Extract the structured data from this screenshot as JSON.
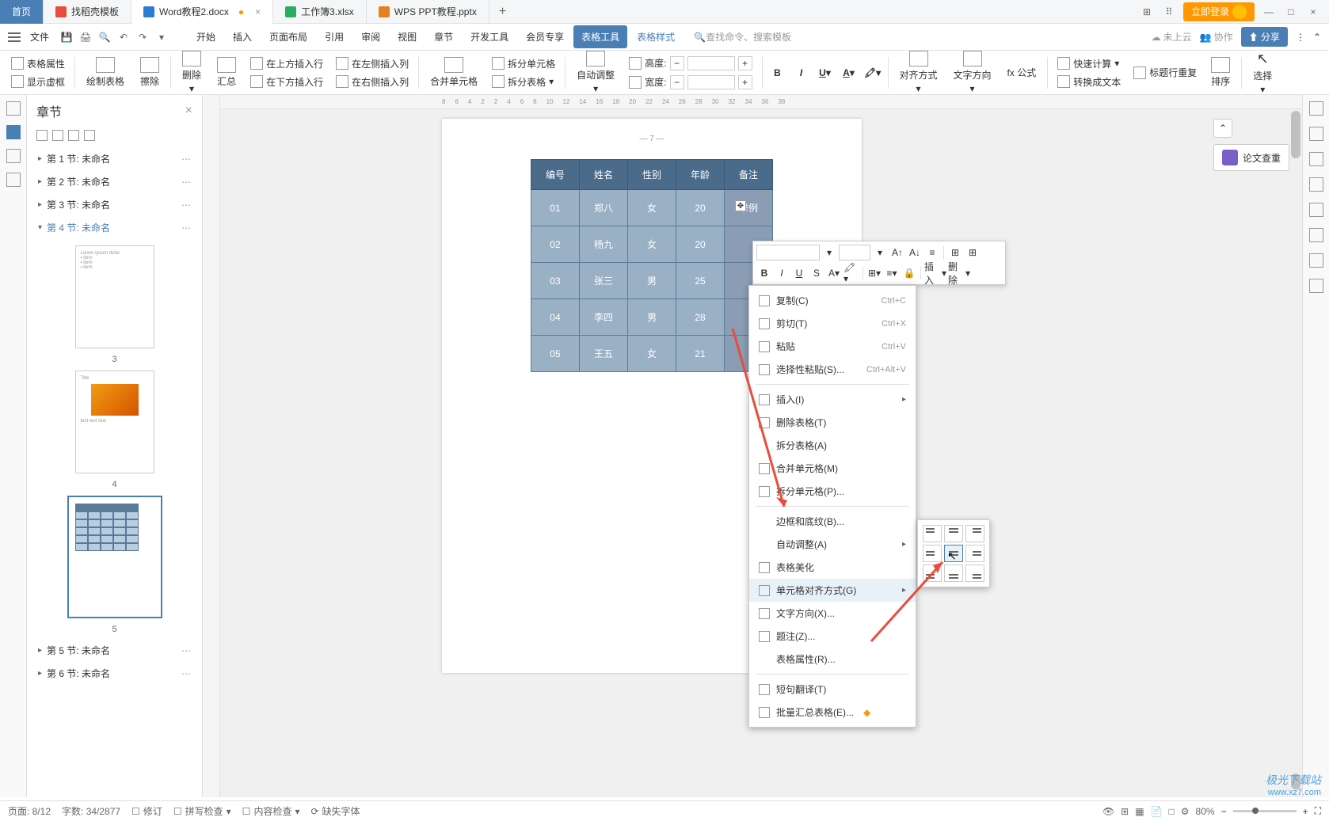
{
  "tabs": {
    "home": "首页",
    "items": [
      {
        "icon": "red",
        "label": "找稻壳模板"
      },
      {
        "icon": "blue",
        "label": "Word教程2.docx",
        "active": true,
        "modified": true
      },
      {
        "icon": "green",
        "label": "工作簿3.xlsx"
      },
      {
        "icon": "orange",
        "label": "WPS PPT教程.pptx"
      }
    ]
  },
  "title_bar": {
    "login": "立即登录"
  },
  "file_menu": "文件",
  "menu": {
    "items": [
      "开始",
      "插入",
      "页面布局",
      "引用",
      "审阅",
      "视图",
      "章节",
      "开发工具",
      "会员专享"
    ],
    "active": "表格工具",
    "link": "表格样式"
  },
  "search": {
    "placeholder": "查找命令、搜索模板"
  },
  "toolbar_right": {
    "cloud": "未上云",
    "collab": "协作",
    "share": "分享"
  },
  "ribbon": {
    "table_props": "表格属性",
    "show_grid": "显示虚框",
    "draw_table": "绘制表格",
    "eraser": "擦除",
    "delete": "删除",
    "summary": "汇总",
    "insert_above": "在上方插入行",
    "insert_below": "在下方插入行",
    "insert_left": "在左侧插入列",
    "insert_right": "在右侧插入列",
    "merge": "合并单元格",
    "split_cell": "拆分单元格",
    "split_table": "拆分表格",
    "autofit": "自动调整",
    "height": "高度:",
    "width": "宽度:",
    "align": "对齐方式",
    "text_dir": "文字方向",
    "formula": "fx 公式",
    "quick_calc": "快速计算",
    "repeat_header": "标题行重复",
    "to_text": "转换成文本",
    "sort": "排序",
    "select": "选择"
  },
  "ruler": [
    "8",
    "6",
    "4",
    "2",
    "",
    "2",
    "4",
    "6",
    "8",
    "10",
    "12",
    "14",
    "16",
    "18",
    "20",
    "22",
    "24",
    "26",
    "28",
    "30",
    "32",
    "34",
    "36",
    "38"
  ],
  "chapter_panel": {
    "title": "章节",
    "items": [
      {
        "label": "第 1 节: 未命名"
      },
      {
        "label": "第 2 节: 未命名"
      },
      {
        "label": "第 3 节: 未命名"
      },
      {
        "label": "第 4 节: 未命名",
        "active": true
      },
      {
        "label": "第 5 节: 未命名"
      },
      {
        "label": "第 6 节: 未命名"
      }
    ],
    "thumb_labels": [
      "3",
      "4",
      "5"
    ]
  },
  "page_number": "— 7 —",
  "table": {
    "headers": [
      "编号",
      "姓名",
      "性别",
      "年龄",
      "备注"
    ],
    "rows": [
      {
        "id": "01",
        "name": "郑八",
        "gender": "女",
        "age": "20",
        "note": "举例"
      },
      {
        "id": "02",
        "name": "杨九",
        "gender": "女",
        "age": "20",
        "note": ""
      },
      {
        "id": "03",
        "name": "张三",
        "gender": "男",
        "age": "25",
        "note": ""
      },
      {
        "id": "04",
        "name": "李四",
        "gender": "男",
        "age": "28",
        "note": ""
      },
      {
        "id": "05",
        "name": "王五",
        "gender": "女",
        "age": "21",
        "note": ""
      }
    ]
  },
  "side_panel": {
    "plagiarism": "论文查重"
  },
  "mini_toolbar": {
    "insert": "插入",
    "delete": "删除"
  },
  "context_menu": {
    "copy": "复制(C)",
    "copy_key": "Ctrl+C",
    "cut": "剪切(T)",
    "cut_key": "Ctrl+X",
    "paste": "粘贴",
    "paste_key": "Ctrl+V",
    "paste_special": "选择性粘贴(S)...",
    "paste_special_key": "Ctrl+Alt+V",
    "insert": "插入(I)",
    "delete_table": "删除表格(T)",
    "split_table": "拆分表格(A)",
    "merge_cells": "合并单元格(M)",
    "split_cells": "拆分单元格(P)...",
    "borders": "边框和底纹(B)...",
    "autofit": "自动调整(A)",
    "beautify": "表格美化",
    "cell_align": "单元格对齐方式(G)",
    "text_dir": "文字方向(X)...",
    "caption": "题注(Z)...",
    "table_props": "表格属性(R)...",
    "translate": "短句翻译(T)",
    "batch_summary": "批量汇总表格(E)..."
  },
  "status": {
    "page": "页面: 8/12",
    "words": "字数: 34/2877",
    "revision": "修订",
    "spell": "拼写检查",
    "content": "内容检查",
    "missing_font": "缺失字体",
    "zoom": "80%"
  },
  "watermark": {
    "line1": "极光下载站",
    "line2": "www.xz7.com"
  }
}
